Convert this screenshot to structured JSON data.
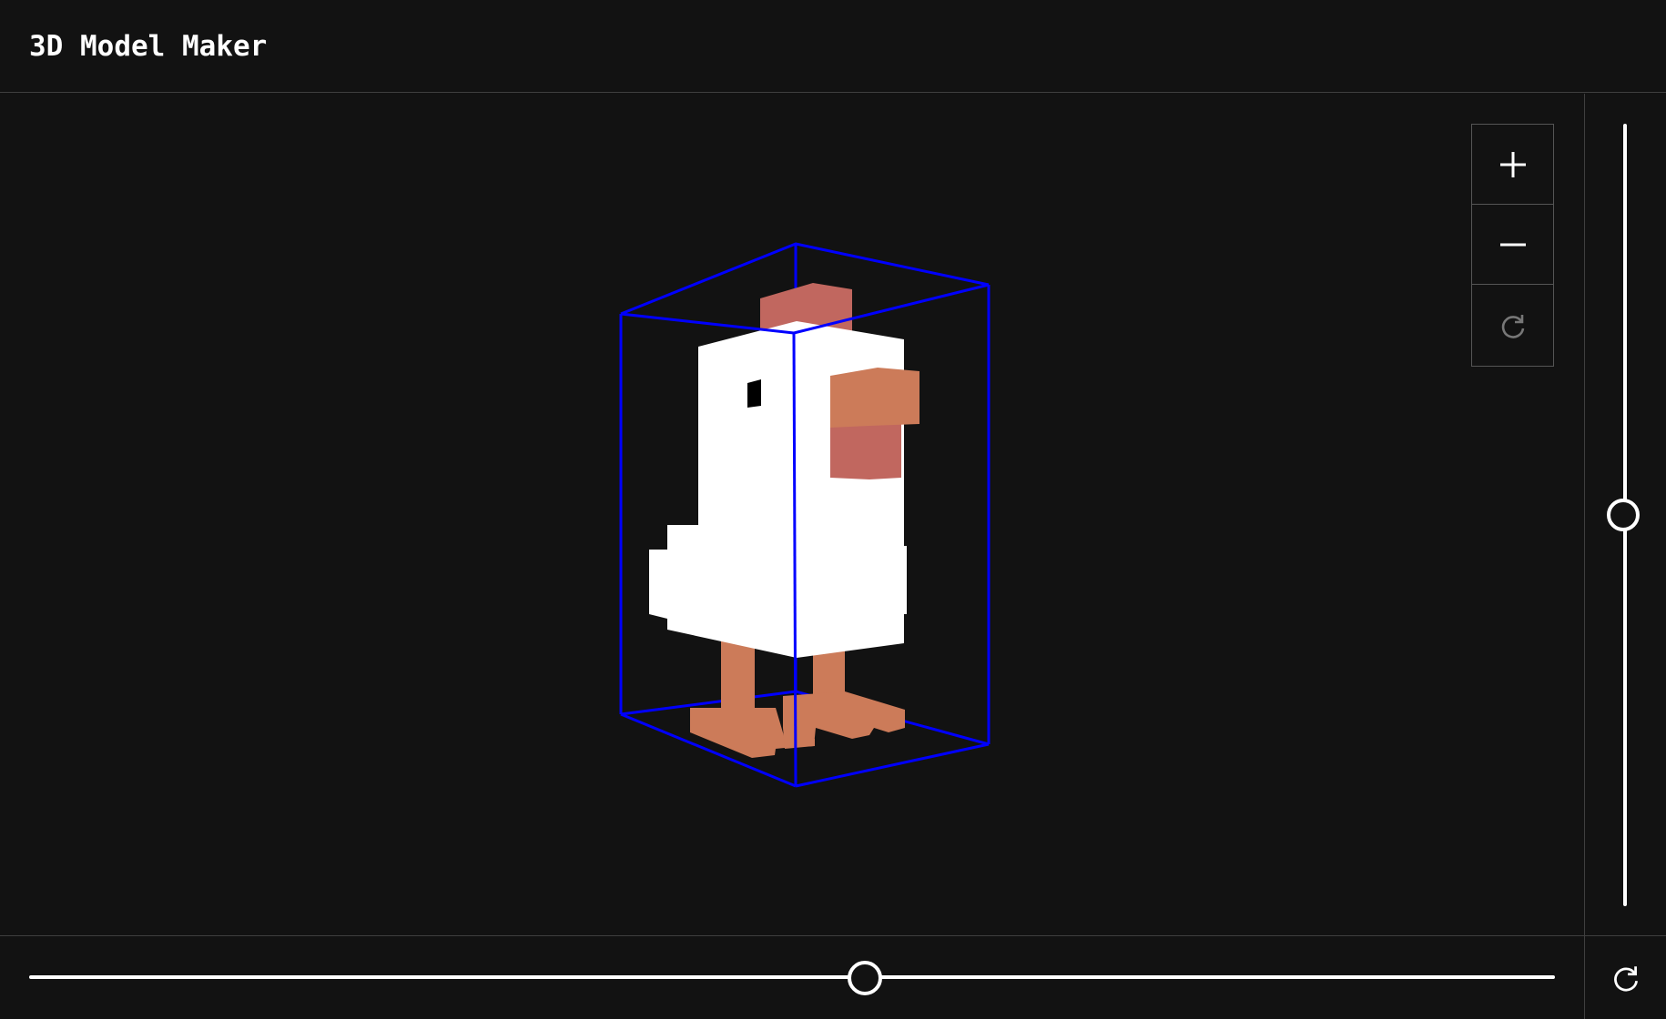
{
  "app": {
    "title": "3D Model Maker"
  },
  "viewport": {
    "model_name": "chicken-voxel-model",
    "bounding_box_color": "#0000ff",
    "model_colors": {
      "body": "#ffffff",
      "comb": "#c1675f",
      "beak": "#cc7b59",
      "wattle": "#c1675f",
      "legs": "#cc7b59",
      "eye": "#000000"
    }
  },
  "zoom_controls": {
    "zoom_in_icon": "plus-icon",
    "zoom_out_icon": "minus-icon",
    "reset_icon": "rotate-clockwise-icon",
    "reset_disabled": true
  },
  "sliders": {
    "vertical_rotation": {
      "value": 0.5
    },
    "horizontal_rotation": {
      "value": 0.548
    }
  },
  "corner": {
    "reset_icon": "rotate-clockwise-icon"
  },
  "colors": {
    "background": "#121212",
    "divider": "#3f3f3f",
    "control_border": "#555555",
    "foreground": "#ffffff",
    "disabled_icon": "#777777"
  }
}
